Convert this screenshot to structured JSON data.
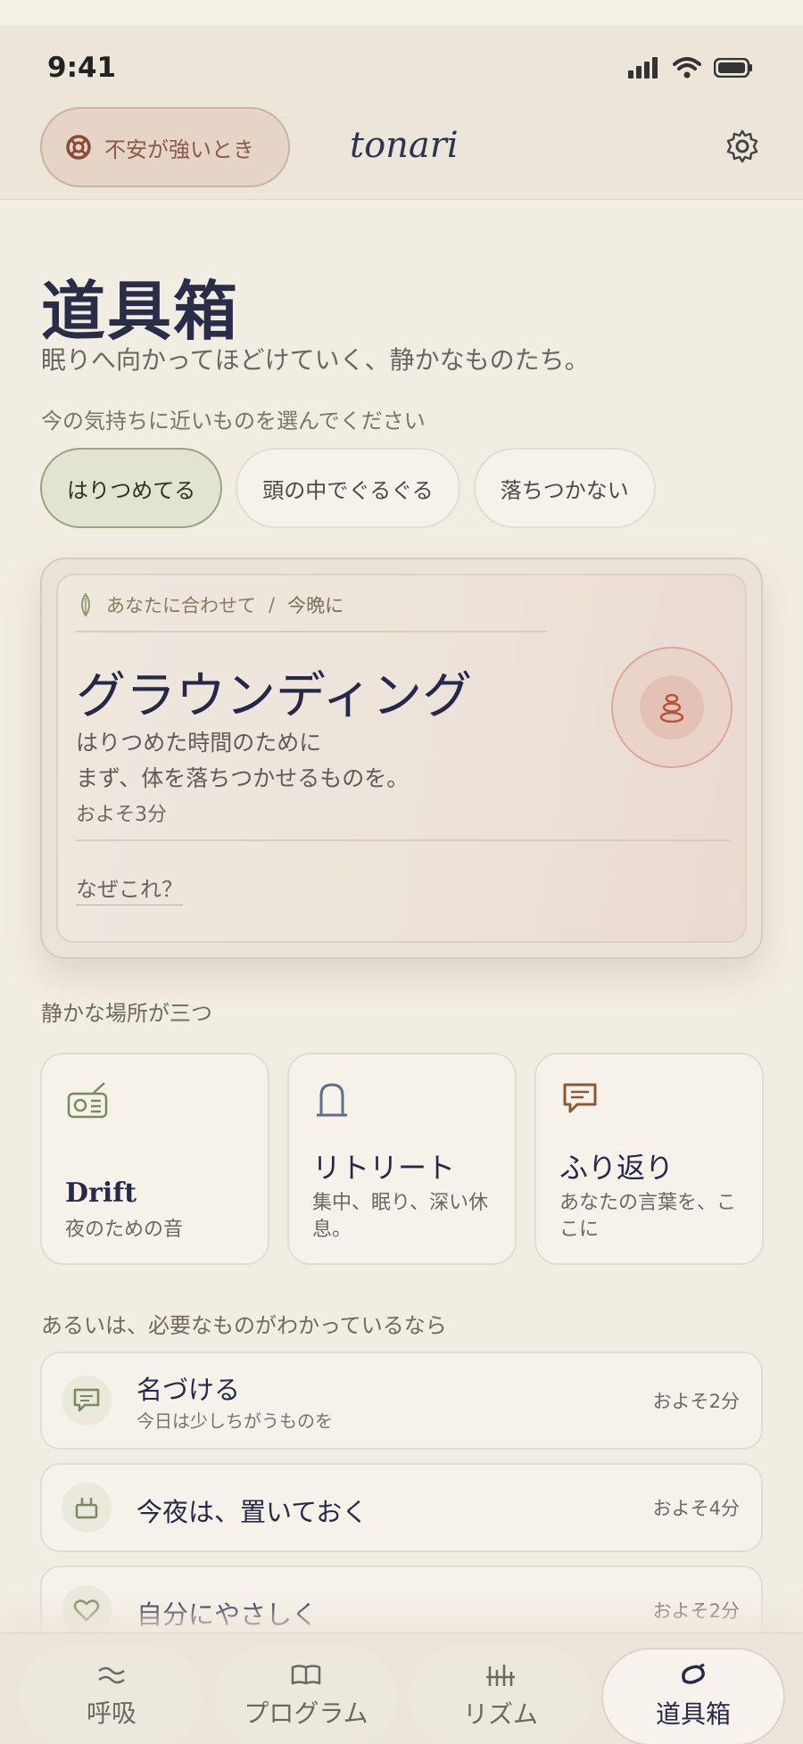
{
  "status_bar": {
    "time": "9:41"
  },
  "header": {
    "sos_label": "不安が強いとき",
    "brand": "tonari"
  },
  "page": {
    "title": "道具箱",
    "subtitle": "眠りへ向かってほどけていく、静かなものたち。",
    "mood_prompt": "今の気持ちに近いものを選んでください",
    "mood_chips": [
      {
        "label": "はりつめてる",
        "selected": true
      },
      {
        "label": "頭の中でぐるぐる",
        "selected": false
      },
      {
        "label": "落ちつかない",
        "selected": false
      }
    ]
  },
  "recommendation": {
    "tag": "あなたに合わせて",
    "separator": "/",
    "when": "今晩に",
    "title": "グラウンディング",
    "line1": "はりつめた時間のために",
    "line2": "まず、体を落ちつかせるものを。",
    "duration": "およそ3分",
    "why_link": "なぜこれ？",
    "accent_color": "#b8523a"
  },
  "places": {
    "label": "静かな場所が三つ",
    "items": [
      {
        "icon": "radio-icon",
        "title": "Drift",
        "desc": "夜のための音"
      },
      {
        "icon": "arch-icon",
        "title": "リトリート",
        "desc": "集中、眠り、深い休息。"
      },
      {
        "icon": "speech-bubble-icon",
        "title": "ふり返り",
        "desc": "あなたの言葉を、ここに"
      }
    ]
  },
  "quick": {
    "label": "あるいは、必要なものがわかっているなら",
    "items": [
      {
        "icon": "chat-icon",
        "title": "名づける",
        "sub": "今日は少しちがうものを",
        "duration": "およそ2分"
      },
      {
        "icon": "basket-icon",
        "title": "今夜は、置いておく",
        "sub": "",
        "duration": "およそ4分"
      },
      {
        "icon": "heart-icon",
        "title": "自分にやさしく",
        "sub": "",
        "duration": "およそ2分"
      }
    ]
  },
  "tabbar": {
    "tabs": [
      {
        "icon": "breath-icon",
        "label": "呼吸",
        "active": false
      },
      {
        "icon": "book-icon",
        "label": "プログラム",
        "active": false
      },
      {
        "icon": "rhythm-icon",
        "label": "リズム",
        "active": false
      },
      {
        "icon": "toolbox-icon",
        "label": "道具箱",
        "active": true
      }
    ]
  }
}
